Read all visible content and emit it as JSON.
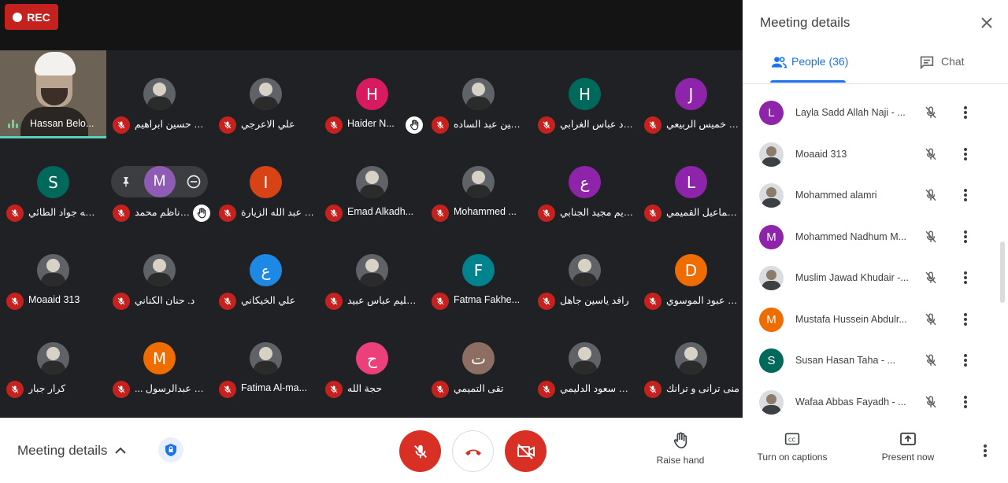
{
  "recording": {
    "label": "REC"
  },
  "self_tile": {
    "name": "Hassan Belo..."
  },
  "grid": {
    "tiles": [
      {
        "name": "ابراهيم حسين ابراهيم",
        "avatar": "",
        "photo": true,
        "hand": false
      },
      {
        "name": "علي الاعرجي",
        "avatar": "",
        "photo": true,
        "hand": false
      },
      {
        "name": "Haider N...",
        "avatar": "H",
        "color": "#d81b60",
        "photo": false,
        "hand": true
      },
      {
        "name": "الحسين عبد الساده ...",
        "avatar": "",
        "photo": true,
        "hand": false
      },
      {
        "name": "محمود عباس الغرابي",
        "avatar": "H",
        "color": "#00695c",
        "photo": false,
        "hand": false
      },
      {
        "name": "ايهاب خميس الربيعي",
        "avatar": "J",
        "color": "#8e24aa",
        "photo": false,
        "hand": false
      },
      {
        "name": "حسن طه جواد الطائي",
        "avatar": "S",
        "color": "#00695c",
        "photo": false,
        "hand": false
      },
      {
        "name": "محمد ناظم محمد",
        "avatar": "",
        "photo": false,
        "hand": true,
        "hidden_avatar": true
      },
      {
        "name": "ناجم عبد الله الزيارة",
        "avatar": "I",
        "color": "#d84315",
        "photo": false,
        "hand": false
      },
      {
        "name": "Emad Alkadh...",
        "avatar": "",
        "photo": true,
        "hand": false
      },
      {
        "name": "Mohammed ...",
        "avatar": "",
        "photo": true,
        "hand": false
      },
      {
        "name": "عبدالكريم مجيد الجنابي",
        "avatar": "ع",
        "color": "#8e24aa",
        "photo": false,
        "hand": false
      },
      {
        "name": "اسماعيل القميمي ...",
        "avatar": "L",
        "color": "#8e24aa",
        "photo": false,
        "hand": false
      },
      {
        "name": "Moaaid 313",
        "avatar": "",
        "photo": true,
        "hand": false
      },
      {
        "name": "د. حنان الكناني",
        "avatar": "",
        "photo": true,
        "hand": false
      },
      {
        "name": "علي الخيكاني",
        "avatar": "ع",
        "color": "#1e88e5",
        "photo": false,
        "hand": false
      },
      {
        "name": "حليم عباس عبيد - ...",
        "avatar": "",
        "photo": true,
        "hand": false
      },
      {
        "name": "Fatma Fakhe...",
        "avatar": "F",
        "color": "#00838f",
        "photo": false,
        "hand": false
      },
      {
        "name": "رافد ياسين جاهل",
        "avatar": "",
        "photo": true,
        "hand": false
      },
      {
        "name": "محمد عبود الموسوي",
        "avatar": "D",
        "color": "#ef6c00",
        "photo": false,
        "hand": false
      },
      {
        "name": "كرار جبار",
        "avatar": "",
        "photo": true,
        "hand": false
      },
      {
        "name": "... حسين عبدالرسول",
        "avatar": "M",
        "color": "#ef6c00",
        "photo": false,
        "hand": false
      },
      {
        "name": "Fatima Al-ma...",
        "avatar": "",
        "photo": true,
        "hand": false
      },
      {
        "name": "حجة الله",
        "avatar": "ح",
        "color": "#ec407a",
        "photo": false,
        "hand": false
      },
      {
        "name": "تقى التميمي",
        "avatar": "ت",
        "color": "#8d6e63",
        "photo": false,
        "hand": false
      },
      {
        "name": "رياض سعود الدليمي",
        "avatar": "",
        "photo": true,
        "hand": false
      },
      {
        "name": "منى ترانى و ترانك",
        "avatar": "",
        "photo": true,
        "hand": false
      }
    ],
    "hover_avatar": "M"
  },
  "panel": {
    "title": "Meeting details",
    "tab_people": "People (36)",
    "tab_chat": "Chat",
    "people": [
      {
        "name": "Layla Sadd Allah Naji - ...",
        "avatar": "L",
        "color": "#8e24aa",
        "photo": false
      },
      {
        "name": "Moaaid 313",
        "avatar": "",
        "photo": true
      },
      {
        "name": "Mohammed alamri",
        "avatar": "",
        "photo": true
      },
      {
        "name": "Mohammed Nadhum M...",
        "avatar": "M",
        "color": "#8e24aa",
        "photo": false
      },
      {
        "name": "Muslim Jawad Khudair -...",
        "avatar": "",
        "photo": true
      },
      {
        "name": "Mustafa Hussein Abdulr...",
        "avatar": "M",
        "color": "#ef6c00",
        "photo": false
      },
      {
        "name": "Susan Hasan Taha - ...",
        "avatar": "S",
        "color": "#00695c",
        "photo": false
      },
      {
        "name": "Wafaa Abbas Fayadh - ...",
        "avatar": "",
        "photo": true
      }
    ]
  },
  "bottom": {
    "meeting_details": "Meeting details",
    "raise_hand": "Raise hand",
    "captions": "Turn on captions",
    "present": "Present now"
  },
  "colors": {
    "accent": "#1a73e8",
    "danger": "#d93025",
    "muted_mic": "#c5221f"
  }
}
